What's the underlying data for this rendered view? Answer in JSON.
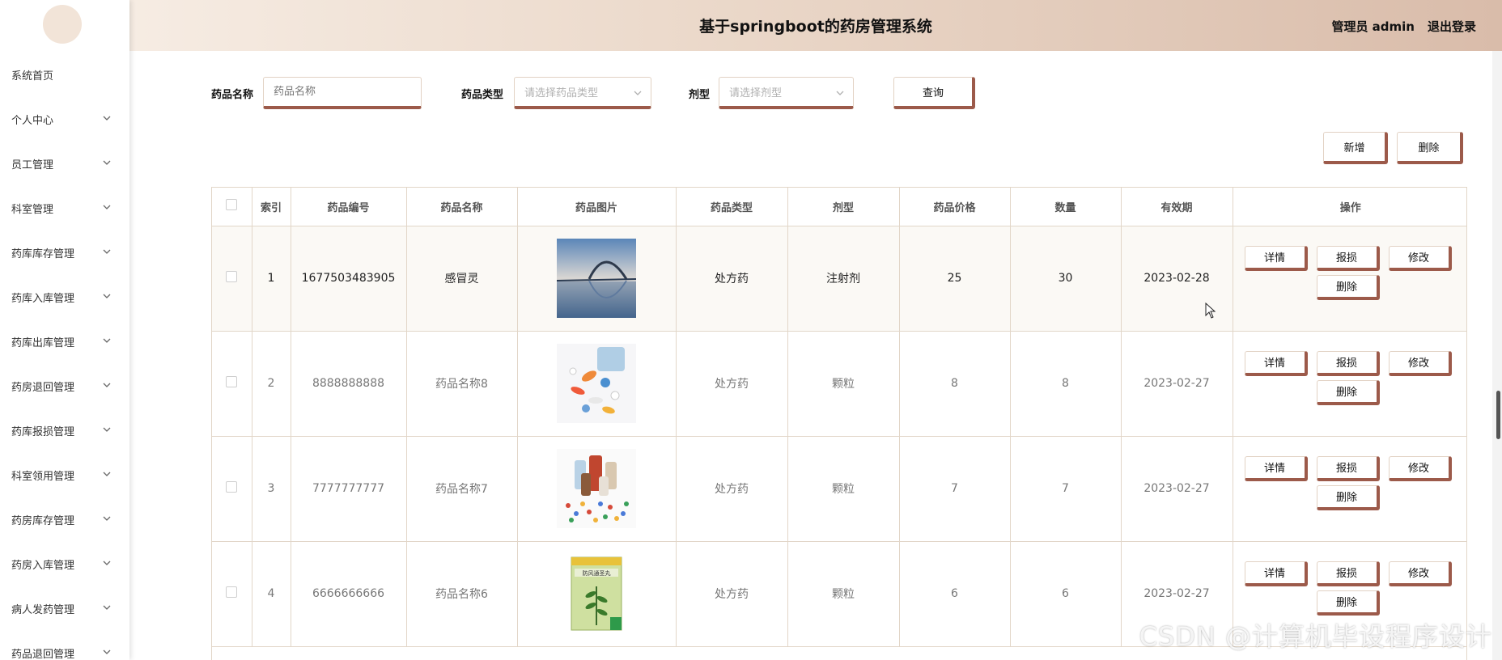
{
  "header": {
    "title": "基于springboot的药房管理系统",
    "user": "管理员 admin",
    "logout": "退出登录"
  },
  "sidebar": {
    "items": [
      {
        "label": "系统首页",
        "has_arrow": false
      },
      {
        "label": "个人中心",
        "has_arrow": true
      },
      {
        "label": "员工管理",
        "has_arrow": true
      },
      {
        "label": "科室管理",
        "has_arrow": true
      },
      {
        "label": "药库库存管理",
        "has_arrow": true
      },
      {
        "label": "药库入库管理",
        "has_arrow": true
      },
      {
        "label": "药库出库管理",
        "has_arrow": true
      },
      {
        "label": "药房退回管理",
        "has_arrow": true
      },
      {
        "label": "药库报损管理",
        "has_arrow": true
      },
      {
        "label": "科室领用管理",
        "has_arrow": true
      },
      {
        "label": "药房库存管理",
        "has_arrow": true
      },
      {
        "label": "药房入库管理",
        "has_arrow": true
      },
      {
        "label": "病人发药管理",
        "has_arrow": true
      },
      {
        "label": "药品退回管理",
        "has_arrow": true
      }
    ]
  },
  "search": {
    "name_label": "药品名称",
    "name_placeholder": "药品名称",
    "type_label": "药品类型",
    "type_placeholder": "请选择药品类型",
    "form_label": "剂型",
    "form_placeholder": "请选择剂型",
    "query_button": "查询"
  },
  "actions": {
    "add": "新增",
    "delete": "删除"
  },
  "table": {
    "columns": [
      "索引",
      "药品编号",
      "药品名称",
      "药品图片",
      "药品类型",
      "剂型",
      "药品价格",
      "数量",
      "有效期",
      "操作"
    ],
    "row_buttons": {
      "detail": "详情",
      "loss": "报损",
      "edit": "修改",
      "delete": "删除"
    },
    "rows": [
      {
        "index": "1",
        "code": "1677503483905",
        "name": "感冒灵",
        "image": "bridge-photo",
        "type": "处方药",
        "form": "注射剂",
        "price": "25",
        "qty": "30",
        "expiry": "2023-02-28"
      },
      {
        "index": "2",
        "code": "8888888888",
        "name": "药品名称8",
        "image": "pills-photo",
        "type": "处方药",
        "form": "颗粒",
        "price": "8",
        "qty": "8",
        "expiry": "2023-02-27"
      },
      {
        "index": "3",
        "code": "7777777777",
        "name": "药品名称7",
        "image": "bottles-photo",
        "type": "处方药",
        "form": "颗粒",
        "price": "7",
        "qty": "7",
        "expiry": "2023-02-27"
      },
      {
        "index": "4",
        "code": "6666666666",
        "name": "药品名称6",
        "image": "medicine-box-photo",
        "type": "处方药",
        "form": "颗粒",
        "price": "6",
        "qty": "6",
        "expiry": "2023-02-27"
      }
    ],
    "box_label": "防风通圣丸"
  },
  "watermark": "CSDN @计算机毕设程序设计",
  "colors": {
    "accent": "#9c5a4a",
    "header_start": "#f6ece3",
    "header_end": "#d9bcaa",
    "border": "#e2d6c8"
  }
}
